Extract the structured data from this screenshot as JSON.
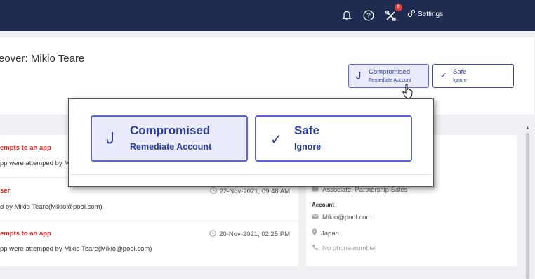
{
  "nav": {
    "badge_count": "5",
    "settings_label": "Settings"
  },
  "header": {
    "title": "eover: Mikio Teare",
    "compromised_label": "Compromised",
    "compromised_sub": "Remediate Account",
    "safe_label": "Safe",
    "safe_sub": "Ignore"
  },
  "activities": [
    {
      "title": "empts to an app",
      "desc": "pp were attemped by Mik",
      "date": ""
    },
    {
      "title": "ser",
      "desc": "d by Mikio Teare(Mikio@pool.com)",
      "date": "22-Nov-2021, 09:48 AM"
    },
    {
      "title": "empts to an app",
      "desc": "pp were attemped by Mikio Teare(Mikio@pool.com)",
      "date": "20-Nov-2021, 02:25 PM"
    }
  ],
  "profile": {
    "role": "Associate, Partnership Sales",
    "account_label": "Account",
    "email": "Mikio@pool.com",
    "location": "Japan",
    "phone": "No phone number"
  },
  "popup": {
    "compromised_label": "Compromised",
    "compromised_sub": "Remediate Account",
    "safe_label": "Safe",
    "safe_sub": "Ignore"
  },
  "icons": {
    "bell": "bell-icon",
    "help": "help-icon",
    "tools": "tools-icon",
    "settings": "gear-icon",
    "hook": "hook-icon",
    "check": "check-icon",
    "clock": "clock-icon",
    "mail": "mail-icon",
    "pin": "location-pin-icon",
    "phone": "phone-icon"
  },
  "colors": {
    "nav_bg": "#1f2b50",
    "accent": "#2c3e9c",
    "danger": "#e0201f"
  }
}
